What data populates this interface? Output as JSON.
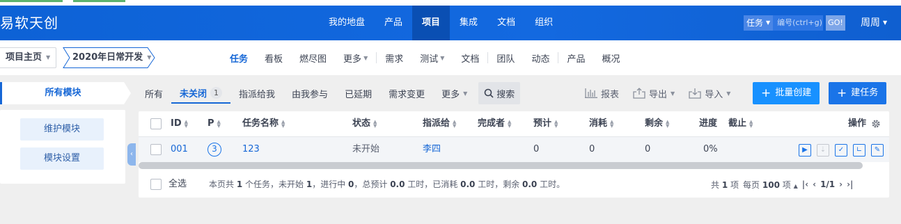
{
  "app": {
    "title": "易软天创"
  },
  "main_nav": [
    {
      "label": "我的地盘",
      "active": false
    },
    {
      "label": "产品",
      "active": false
    },
    {
      "label": "项目",
      "active": true
    },
    {
      "label": "集成",
      "active": false
    },
    {
      "label": "文档",
      "active": false
    },
    {
      "label": "组织",
      "active": false
    }
  ],
  "header_search": {
    "type": "任务",
    "placeholder": "编号(ctrl+g)",
    "go": "GO!"
  },
  "user": {
    "name": "周周"
  },
  "breadcrumb": {
    "home": "项目主页",
    "project": "2020年日常开发"
  },
  "sub_nav": {
    "group1": [
      {
        "label": "任务",
        "active": true,
        "has_caret": false
      },
      {
        "label": "看板",
        "active": false,
        "has_caret": false
      },
      {
        "label": "燃尽图",
        "active": false,
        "has_caret": false
      },
      {
        "label": "更多",
        "active": false,
        "has_caret": true
      }
    ],
    "group2": [
      {
        "label": "需求",
        "has_caret": false
      },
      {
        "label": "测试",
        "has_caret": true
      },
      {
        "label": "文档",
        "has_caret": false
      }
    ],
    "group3": [
      {
        "label": "团队"
      },
      {
        "label": "动态"
      }
    ],
    "group4": [
      {
        "label": "产品"
      },
      {
        "label": "概况"
      }
    ]
  },
  "sidebar": {
    "all_modules": "所有模块",
    "maintain": "维护模块",
    "settings": "模块设置"
  },
  "filters": {
    "all": "所有",
    "unclosed": "未关闭",
    "unclosed_count": "1",
    "assigned": "指派给我",
    "involved": "由我参与",
    "delayed": "已延期",
    "story_changed": "需求变更",
    "more": "更多",
    "search": "搜索"
  },
  "actions": {
    "report": "报表",
    "export": "导出",
    "import": "导入",
    "batch_create": "批量创建",
    "create": "建任务"
  },
  "table": {
    "headers": {
      "id": "ID",
      "pri": "P",
      "name": "任务名称",
      "status": "状态",
      "assigned_to": "指派给",
      "finished_by": "完成者",
      "estimate": "预计",
      "consumed": "消耗",
      "left": "剩余",
      "progress": "进度",
      "deadline": "截止",
      "actions": "操作"
    },
    "rows": [
      {
        "id": "001",
        "pri": "3",
        "name": "123",
        "status": "未开始",
        "assigned_to": "李四",
        "finished_by": "",
        "estimate": "0",
        "consumed": "0",
        "left": "0",
        "progress": "0%",
        "deadline": ""
      }
    ]
  },
  "footer": {
    "select_all": "全选",
    "summary_parts": [
      "本页共 ",
      "1",
      " 个任务，未开始 ",
      "1",
      "，进行中 ",
      "0",
      "，总预计 ",
      "0.0",
      " 工时，已消耗 ",
      "0.0",
      " 工时，剩余 ",
      "0.0",
      " 工时。"
    ],
    "pager": {
      "total_prefix": "共",
      "total": "1",
      "total_suffix": "项",
      "per_page_prefix": "每页",
      "per_page": "100",
      "per_page_suffix": "项",
      "page": "1/1"
    }
  },
  "colors": {
    "brand": "#1367de",
    "accent": "#1667d6",
    "primary_button": "#1a74e8"
  }
}
